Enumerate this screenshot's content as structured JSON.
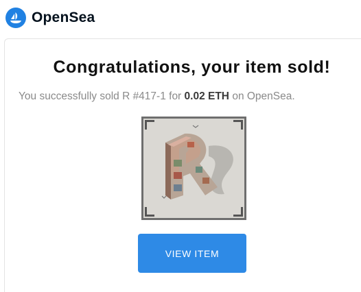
{
  "brand": {
    "name": "OpenSea",
    "icon": "opensea-logo-icon",
    "color": "#2081e2"
  },
  "email": {
    "title": "Congratulations, your item sold!",
    "message_prefix": "You successfully sold R #417-1 for ",
    "price": "0.02 ETH",
    "message_suffix": " on OpenSea.",
    "item_image": "nft-artwork-image",
    "button_label": "VIEW ITEM",
    "button_color": "#2e8ae6"
  }
}
